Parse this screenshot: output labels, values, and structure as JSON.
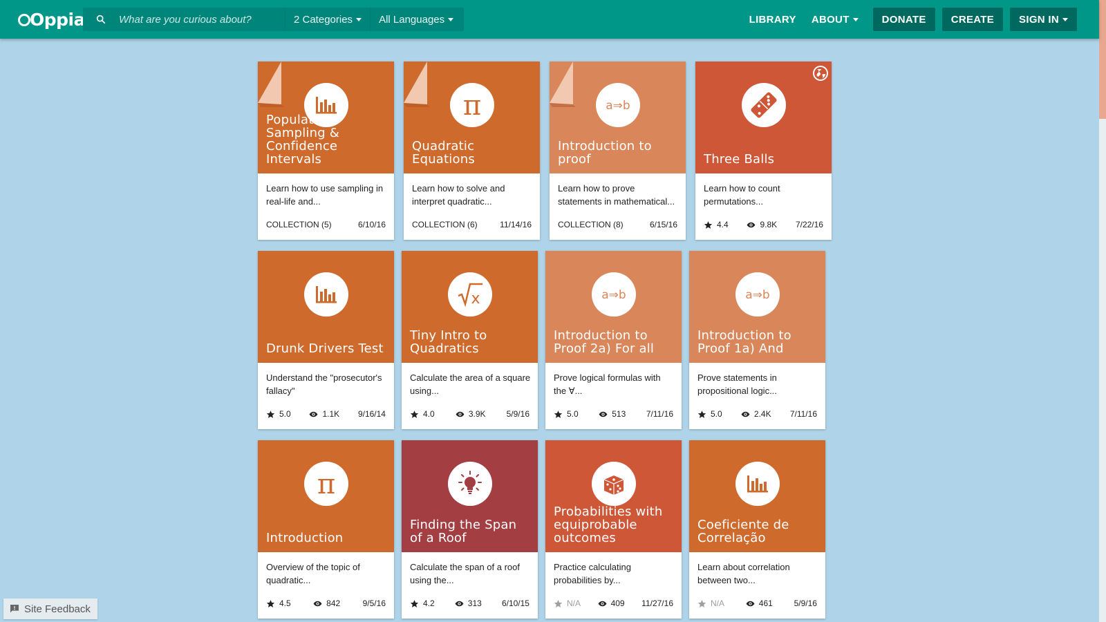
{
  "header": {
    "logo_text": "Oppia",
    "search_placeholder": "What are you curious about?",
    "categories_label": "2 Categories",
    "languages_label": "All Languages",
    "nav": {
      "library": "LIBRARY",
      "about": "ABOUT",
      "donate": "DONATE",
      "create": "CREATE",
      "sign_in": "SIGN IN"
    }
  },
  "colors": {
    "topbar": "#009688",
    "background": "#afd4e9",
    "card_orange": "#cf6a2d",
    "card_light_orange": "#d8865a",
    "card_red_orange": "#cd5737",
    "card_maroon": "#a33e42"
  },
  "cards": [
    {
      "title": "Population Sampling & Confidence Intervals",
      "icon": "bar-chart-icon",
      "description": "Learn how to use sampling in real-life and...",
      "collection": "COLLECTION (5)",
      "date": "6/10/16",
      "color": "#cf6a2d"
    },
    {
      "title": "Quadratic Equations",
      "icon": "pi-icon",
      "description": "Learn how to solve and interpret quadratic...",
      "collection": "COLLECTION (6)",
      "date": "11/14/16",
      "color": "#cf6a2d"
    },
    {
      "title": "Introduction to proof",
      "icon": "implies-icon",
      "description": "Learn how to prove statements in mathematical...",
      "collection": "COLLECTION (8)",
      "date": "6/15/16",
      "color": "#d8865a"
    },
    {
      "title": "Three Balls",
      "icon": "domino-icon",
      "description": "Learn how to count permutations...",
      "rating": "4.4",
      "views": "9.8K",
      "date": "7/22/16",
      "color": "#cd5737"
    },
    {
      "title": "Drunk Drivers Test",
      "icon": "bar-chart-icon",
      "description": "Understand the \"prosecutor's fallacy\"",
      "rating": "5.0",
      "views": "1.1K",
      "date": "9/16/14",
      "color": "#cf6a2d"
    },
    {
      "title": "Tiny Intro to Quadratics",
      "icon": "sqrt-icon",
      "description": "Calculate the area of a square using...",
      "rating": "4.0",
      "views": "3.9K",
      "date": "5/9/16",
      "color": "#cf6a2d"
    },
    {
      "title": "Introduction to Proof 2a) For all",
      "icon": "implies-icon",
      "description": "Prove logical formulas with the ∀...",
      "rating": "5.0",
      "views": "513",
      "date": "7/11/16",
      "color": "#d8865a"
    },
    {
      "title": "Introduction to Proof 1a) And",
      "icon": "implies-icon",
      "description": "Prove statements in propositional logic...",
      "rating": "5.0",
      "views": "2.4K",
      "date": "7/11/16",
      "color": "#d8865a"
    },
    {
      "title": "Introduction",
      "icon": "pi-icon",
      "description": "Overview of the topic of quadratic...",
      "rating": "4.5",
      "views": "842",
      "date": "9/5/16",
      "color": "#cf6a2d"
    },
    {
      "title": "Finding the Span of a Roof",
      "icon": "lightbulb-icon",
      "description": "Calculate the span of a roof using the...",
      "rating": "4.2",
      "views": "313",
      "date": "6/10/15",
      "color": "#a33e42"
    },
    {
      "title": "Probabilities with equiprobable outcomes",
      "icon": "dice-icon",
      "description": "Practice calculating probabilities by...",
      "rating": "N/A",
      "views": "409",
      "date": "11/27/16",
      "color": "#cd5737"
    },
    {
      "title": "Coeficiente de Correlação",
      "icon": "bar-chart-icon",
      "description": "Learn about correlation between two...",
      "rating": "N/A",
      "views": "461",
      "date": "5/9/16",
      "color": "#cf6a2d"
    }
  ],
  "feedback_label": "Site Feedback"
}
